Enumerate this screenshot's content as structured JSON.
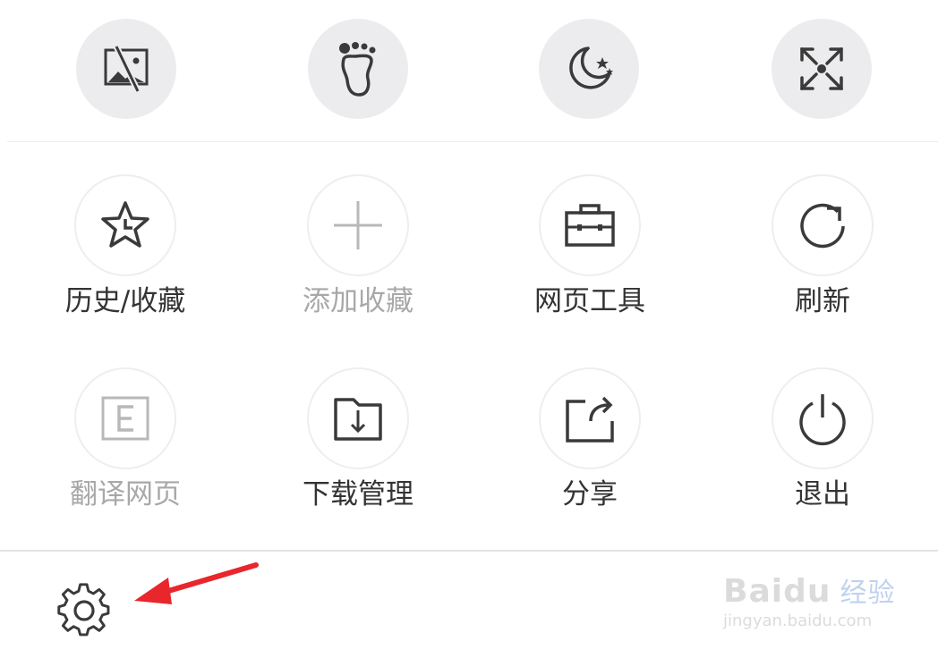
{
  "quick_actions": [
    {
      "name": "no-image-icon"
    },
    {
      "name": "footprint-icon"
    },
    {
      "name": "night-mode-icon"
    },
    {
      "name": "fullscreen-icon"
    }
  ],
  "menu": {
    "row1": [
      {
        "label": "历史/收藏",
        "icon": "star-clock-icon",
        "enabled": true
      },
      {
        "label": "添加收藏",
        "icon": "plus-icon",
        "enabled": false
      },
      {
        "label": "网页工具",
        "icon": "toolbox-icon",
        "enabled": true
      },
      {
        "label": "刷新",
        "icon": "refresh-icon",
        "enabled": true
      }
    ],
    "row2": [
      {
        "label": "翻译网页",
        "icon": "translate-icon",
        "enabled": false
      },
      {
        "label": "下载管理",
        "icon": "download-folder-icon",
        "enabled": true
      },
      {
        "label": "分享",
        "icon": "share-icon",
        "enabled": true
      },
      {
        "label": "退出",
        "icon": "power-icon",
        "enabled": true
      }
    ]
  },
  "bottom": {
    "settings_icon": "gear-icon"
  },
  "annotation": {
    "color": "#e8262b"
  },
  "watermark": {
    "brand": "Baidu",
    "brand_suffix": "经验",
    "url": "jingyan.baidu.com"
  },
  "colors": {
    "icon_dark": "#3a3a3a",
    "icon_disabled": "#b8b8b8",
    "accent_red": "#e8262b"
  }
}
